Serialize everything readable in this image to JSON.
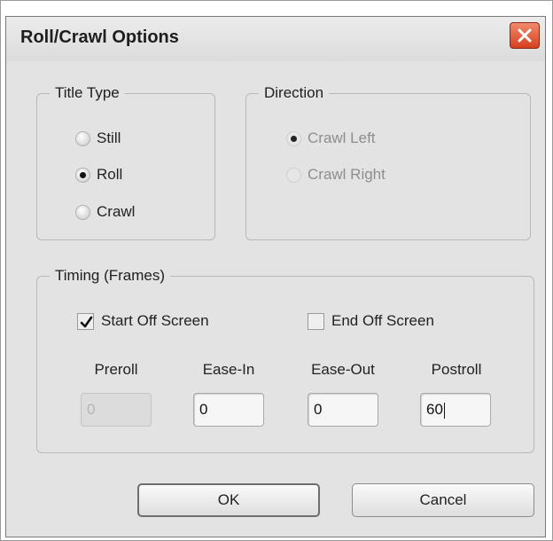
{
  "dialog": {
    "title": "Roll/Crawl Options",
    "close_icon": "close-x-icon"
  },
  "title_type": {
    "legend": "Title Type",
    "options": [
      {
        "label": "Still",
        "checked": false
      },
      {
        "label": "Roll",
        "checked": true
      },
      {
        "label": "Crawl",
        "checked": false
      }
    ]
  },
  "direction": {
    "legend": "Direction",
    "enabled": false,
    "options": [
      {
        "label": "Crawl Left",
        "checked": true
      },
      {
        "label": "Crawl Right",
        "checked": false
      }
    ]
  },
  "timing": {
    "legend": "Timing (Frames)",
    "start_off_screen": {
      "label": "Start Off Screen",
      "checked": true
    },
    "end_off_screen": {
      "label": "End Off Screen",
      "checked": false
    },
    "fields": [
      {
        "label": "Preroll",
        "value": "0",
        "enabled": false
      },
      {
        "label": "Ease-In",
        "value": "0",
        "enabled": true
      },
      {
        "label": "Ease-Out",
        "value": "0",
        "enabled": true
      },
      {
        "label": "Postroll",
        "value": "60",
        "enabled": true
      }
    ]
  },
  "buttons": {
    "ok": "OK",
    "cancel": "Cancel"
  },
  "colors": {
    "close_button": "#d6401f",
    "dialog_bg": "#e3e3e3"
  }
}
